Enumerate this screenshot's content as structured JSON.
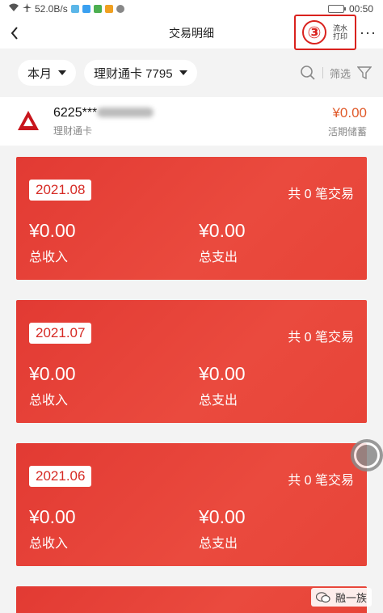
{
  "status_bar": {
    "speed": "52.0B/s",
    "time": "00:50"
  },
  "nav": {
    "title": "交易明细",
    "annotation_number": "③",
    "export_label": "流水打印",
    "more_label": "···"
  },
  "filters": {
    "period": "本月",
    "card": "理财通卡 7795",
    "filter_label": "筛选"
  },
  "account": {
    "number_prefix": "6225***",
    "type": "理财通卡",
    "balance": "¥0.00",
    "kind": "活期储蓄"
  },
  "months": [
    {
      "month": "2021.08",
      "tx_count": "共 0 笔交易",
      "income": "¥0.00",
      "income_label": "总收入",
      "expense": "¥0.00",
      "expense_label": "总支出"
    },
    {
      "month": "2021.07",
      "tx_count": "共 0 笔交易",
      "income": "¥0.00",
      "income_label": "总收入",
      "expense": "¥0.00",
      "expense_label": "总支出"
    },
    {
      "month": "2021.06",
      "tx_count": "共 0 笔交易",
      "income": "¥0.00",
      "income_label": "总收入",
      "expense": "¥0.00",
      "expense_label": "总支出"
    }
  ],
  "watermark": "融一族",
  "colors": {
    "card_red": "#e23a33",
    "accent": "#d9221e",
    "balance_orange": "#e05a2a"
  }
}
